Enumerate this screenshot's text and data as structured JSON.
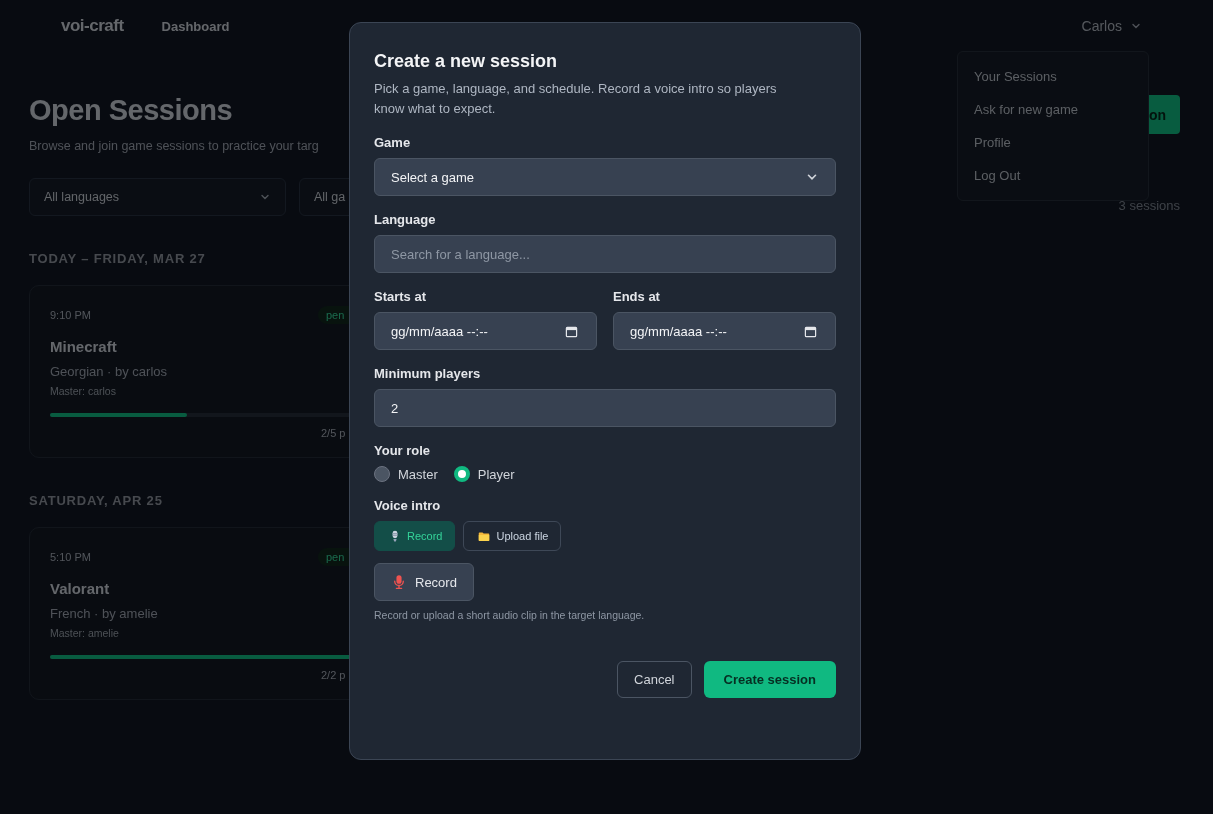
{
  "nav": {
    "logo": "voi-craft",
    "links": [
      "Dashboard"
    ],
    "user": "Carlos"
  },
  "user_menu": {
    "items": [
      "Your Sessions",
      "Ask for new game",
      "Profile",
      "Log Out"
    ]
  },
  "page": {
    "title": "Open Sessions",
    "subtitle": "Browse and join game sessions to practice your targ",
    "primary_button": "on",
    "filters": [
      "All languages",
      "All ga"
    ],
    "count": "3 sessions"
  },
  "groups": [
    {
      "heading": "TODAY – FRIDAY, MAR 27",
      "sessions": [
        {
          "time": "9:10 PM",
          "status": "pen",
          "game": "Minecraft",
          "meta": "Georgian · by carlos",
          "master": "Master: carlos",
          "level": 0.4,
          "players": "2/5 p"
        }
      ]
    },
    {
      "heading": "SATURDAY, APR 25",
      "sessions": [
        {
          "time": "5:10 PM",
          "status": "pen",
          "game": "Valorant",
          "meta": "French · by amelie",
          "master": "Master: amelie",
          "level": 1,
          "players": "2/2 p"
        }
      ]
    }
  ],
  "dialog": {
    "title": "Create a new session",
    "description": "Pick a game, language, and schedule. Record a voice intro so players know what to expect.",
    "game": {
      "label": "Game",
      "value": "Select a game"
    },
    "language": {
      "label": "Language",
      "placeholder": "Search for a language..."
    },
    "starts_at": {
      "label": "Starts at",
      "value": "gg/mm/aaaa --:--"
    },
    "ends_at": {
      "label": "Ends at",
      "value": "gg/mm/aaaa --:--"
    },
    "minimum_players": {
      "label": "Minimum players",
      "value": "2"
    },
    "role": {
      "label": "Your role",
      "options": [
        {
          "label": "Master",
          "selected": false
        },
        {
          "label": "Player",
          "selected": true
        }
      ]
    },
    "voice_intro": {
      "label": "Voice intro",
      "tabs": [
        {
          "label": "Record",
          "kind": "mic",
          "selected": true
        },
        {
          "label": "Upload file",
          "kind": "folder",
          "selected": false
        }
      ],
      "record_button": "Record",
      "hint": "Record or upload a short audio clip in the target language."
    },
    "buttons": [
      {
        "label": "Cancel",
        "kind": "secondary"
      },
      {
        "label": "Create session",
        "kind": "primary"
      }
    ]
  }
}
